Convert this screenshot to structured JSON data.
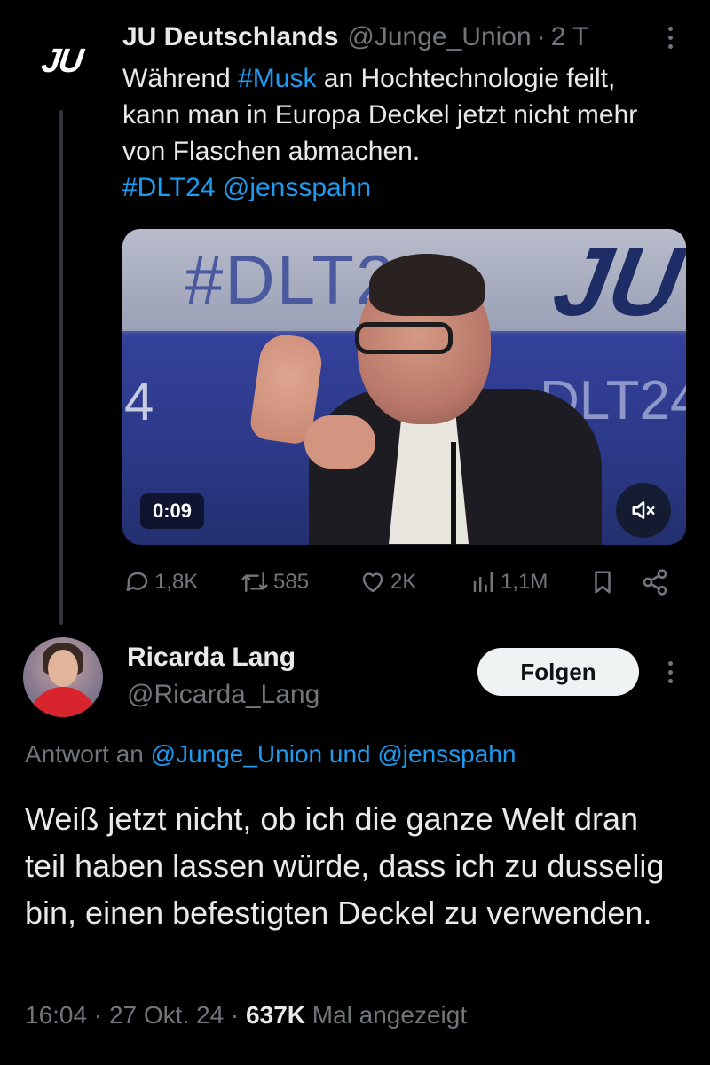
{
  "parent_tweet": {
    "avatar_logo_text": "JU",
    "display_name": "JU Deutschlands",
    "handle": "@Junge_Union",
    "separator": "·",
    "time": "2 T",
    "text_part1": "Während ",
    "hashtag_musk": "#Musk",
    "text_part2": " an Hochtechnologie feilt, kann man in Europa Deckel jetzt nicht mehr von Flaschen abmachen.",
    "hashtag_dlt": "#DLT24",
    "mention_spahn": "@jensspahn",
    "video": {
      "backdrop_hashtag": "#DLT24",
      "backdrop_logo": "JU",
      "stage_text_left": "4",
      "stage_text_right": "DLT24",
      "duration": "0:09",
      "mute_icon": "speaker-muted-icon"
    },
    "actions": {
      "replies": "1,8K",
      "reposts": "585",
      "likes": "2K",
      "views": "1,1M"
    }
  },
  "reply_tweet": {
    "display_name": "Ricarda Lang",
    "handle": "@Ricarda_Lang",
    "follow_label": "Folgen",
    "reply_prefix": "Antwort an ",
    "reply_mention1": "@Junge_Union",
    "reply_and": " und ",
    "reply_mention2": "@jensspahn",
    "text": "Weiß jetzt nicht, ob ich die ganze Welt dran teil haben lassen würde, dass ich zu dusselig bin, einen befestigten Deckel zu verwenden.",
    "time": "16:04",
    "sep1": " · ",
    "date": "27 Okt. 24",
    "sep2": " · ",
    "views_count": "637K",
    "views_label": " Mal angezeigt"
  },
  "colors": {
    "background": "#000000",
    "text": "#e7e9ea",
    "secondary": "#71767b",
    "link": "#1d9bf0",
    "follow_button_bg": "#eff3f4"
  }
}
